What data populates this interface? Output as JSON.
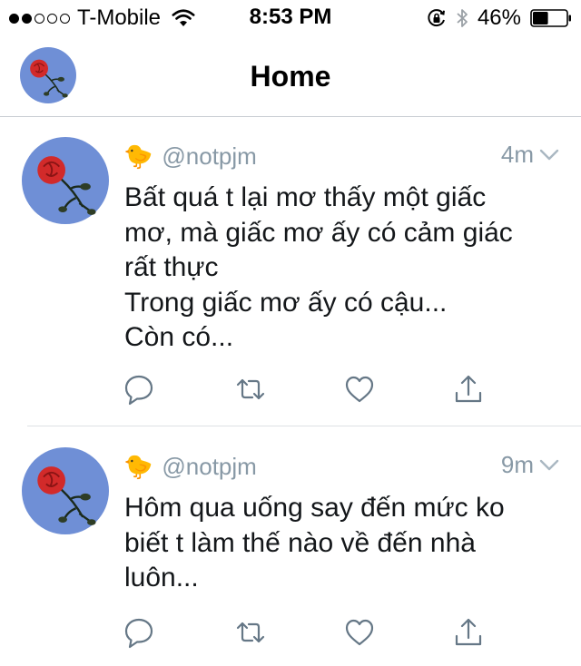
{
  "status_bar": {
    "carrier": "T-Mobile",
    "time": "8:53 PM",
    "battery": "46%",
    "battery_level": 0.46,
    "signal_bars_filled": 2,
    "signal_bars_total": 5
  },
  "nav": {
    "title": "Home"
  },
  "tweets": [
    {
      "handle": "@notpjm",
      "emoji": "🐤",
      "time": "4m",
      "text_lines": [
        "Bất quá t lại mơ thấy một giấc",
        "mơ, mà giấc mơ ấy có cảm giác",
        "rất thực",
        "Trong giấc mơ ấy có cậu...",
        "Còn có..."
      ]
    },
    {
      "handle": "@notpjm",
      "emoji": "🐤",
      "time": "9m",
      "text_lines": [
        "Hôm qua uống say đến mức ko",
        "biết t làm thế nào về đến nhà",
        "luôn..."
      ]
    }
  ],
  "colors": {
    "meta_gray": "#8899a6",
    "icon_gray": "#657786",
    "text": "#14171a",
    "avatar_bg": "#6f8fd6",
    "rose_red": "#d22a2a"
  }
}
